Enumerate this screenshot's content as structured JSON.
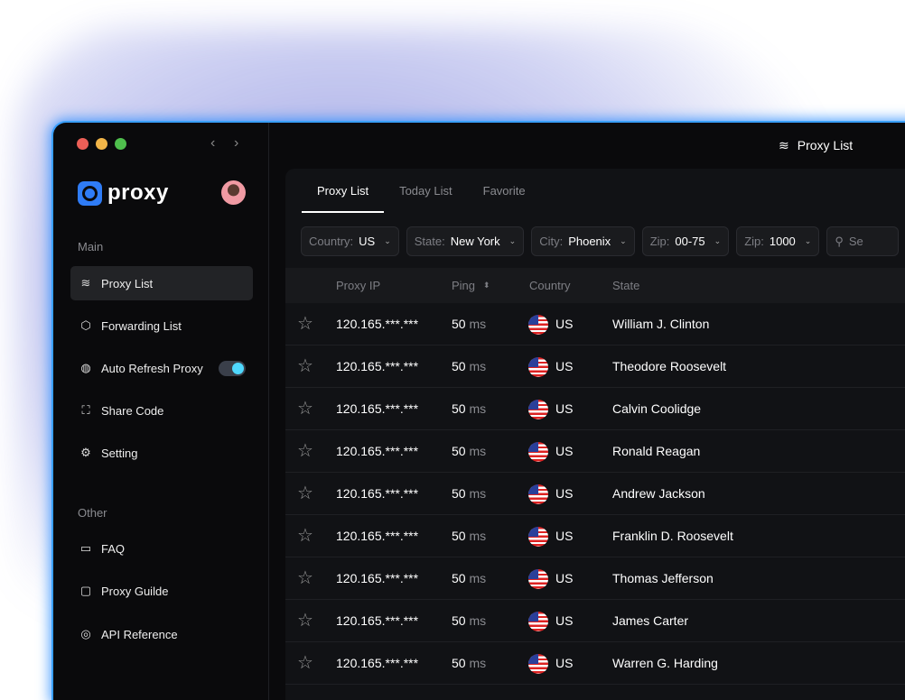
{
  "window": {
    "title": "Proxy List"
  },
  "brand": {
    "name": "proxy",
    "accent": "#2f7cf6"
  },
  "sidebar": {
    "main_label": "Main",
    "items": [
      {
        "label": "Proxy List",
        "icon": "layers-icon",
        "active": true
      },
      {
        "label": "Forwarding List",
        "icon": "cube-icon"
      },
      {
        "label": "Auto Refresh Proxy",
        "icon": "globe-icon",
        "toggle": true
      },
      {
        "label": "Share Code",
        "icon": "scan-icon"
      },
      {
        "label": "Setting",
        "icon": "gear-icon"
      }
    ],
    "other_label": "Other",
    "other_items": [
      {
        "label": "FAQ",
        "icon": "chat-icon"
      },
      {
        "label": "Proxy Guilde",
        "icon": "document-icon"
      },
      {
        "label": "API Reference",
        "icon": "api-icon"
      }
    ]
  },
  "tabs": [
    "Proxy List",
    "Today List",
    "Favorite"
  ],
  "filters": [
    {
      "label": "Country:",
      "value": "US"
    },
    {
      "label": "State:",
      "value": "New York"
    },
    {
      "label": "City:",
      "value": "Phoenix"
    },
    {
      "label": "Zip:",
      "value": "00-75"
    },
    {
      "label": "Zip:",
      "value": "1000"
    }
  ],
  "search": {
    "placeholder": "Se"
  },
  "table": {
    "headers": [
      "Proxy IP",
      "Ping",
      "Country",
      "State"
    ],
    "rows": [
      {
        "ip": "120.165.***.***",
        "ping": "50",
        "unit": "ms",
        "country": "US",
        "state": "William J. Clinton"
      },
      {
        "ip": "120.165.***.***",
        "ping": "50",
        "unit": "ms",
        "country": "US",
        "state": "Theodore Roosevelt"
      },
      {
        "ip": "120.165.***.***",
        "ping": "50",
        "unit": "ms",
        "country": "US",
        "state": "Calvin Coolidge"
      },
      {
        "ip": "120.165.***.***",
        "ping": "50",
        "unit": "ms",
        "country": "US",
        "state": "Ronald Reagan"
      },
      {
        "ip": "120.165.***.***",
        "ping": "50",
        "unit": "ms",
        "country": "US",
        "state": "Andrew Jackson"
      },
      {
        "ip": "120.165.***.***",
        "ping": "50",
        "unit": "ms",
        "country": "US",
        "state": "Franklin D. Roosevelt"
      },
      {
        "ip": "120.165.***.***",
        "ping": "50",
        "unit": "ms",
        "country": "US",
        "state": "Thomas Jefferson"
      },
      {
        "ip": "120.165.***.***",
        "ping": "50",
        "unit": "ms",
        "country": "US",
        "state": "James Carter"
      },
      {
        "ip": "120.165.***.***",
        "ping": "50",
        "unit": "ms",
        "country": "US",
        "state": "Warren G. Harding"
      }
    ]
  }
}
